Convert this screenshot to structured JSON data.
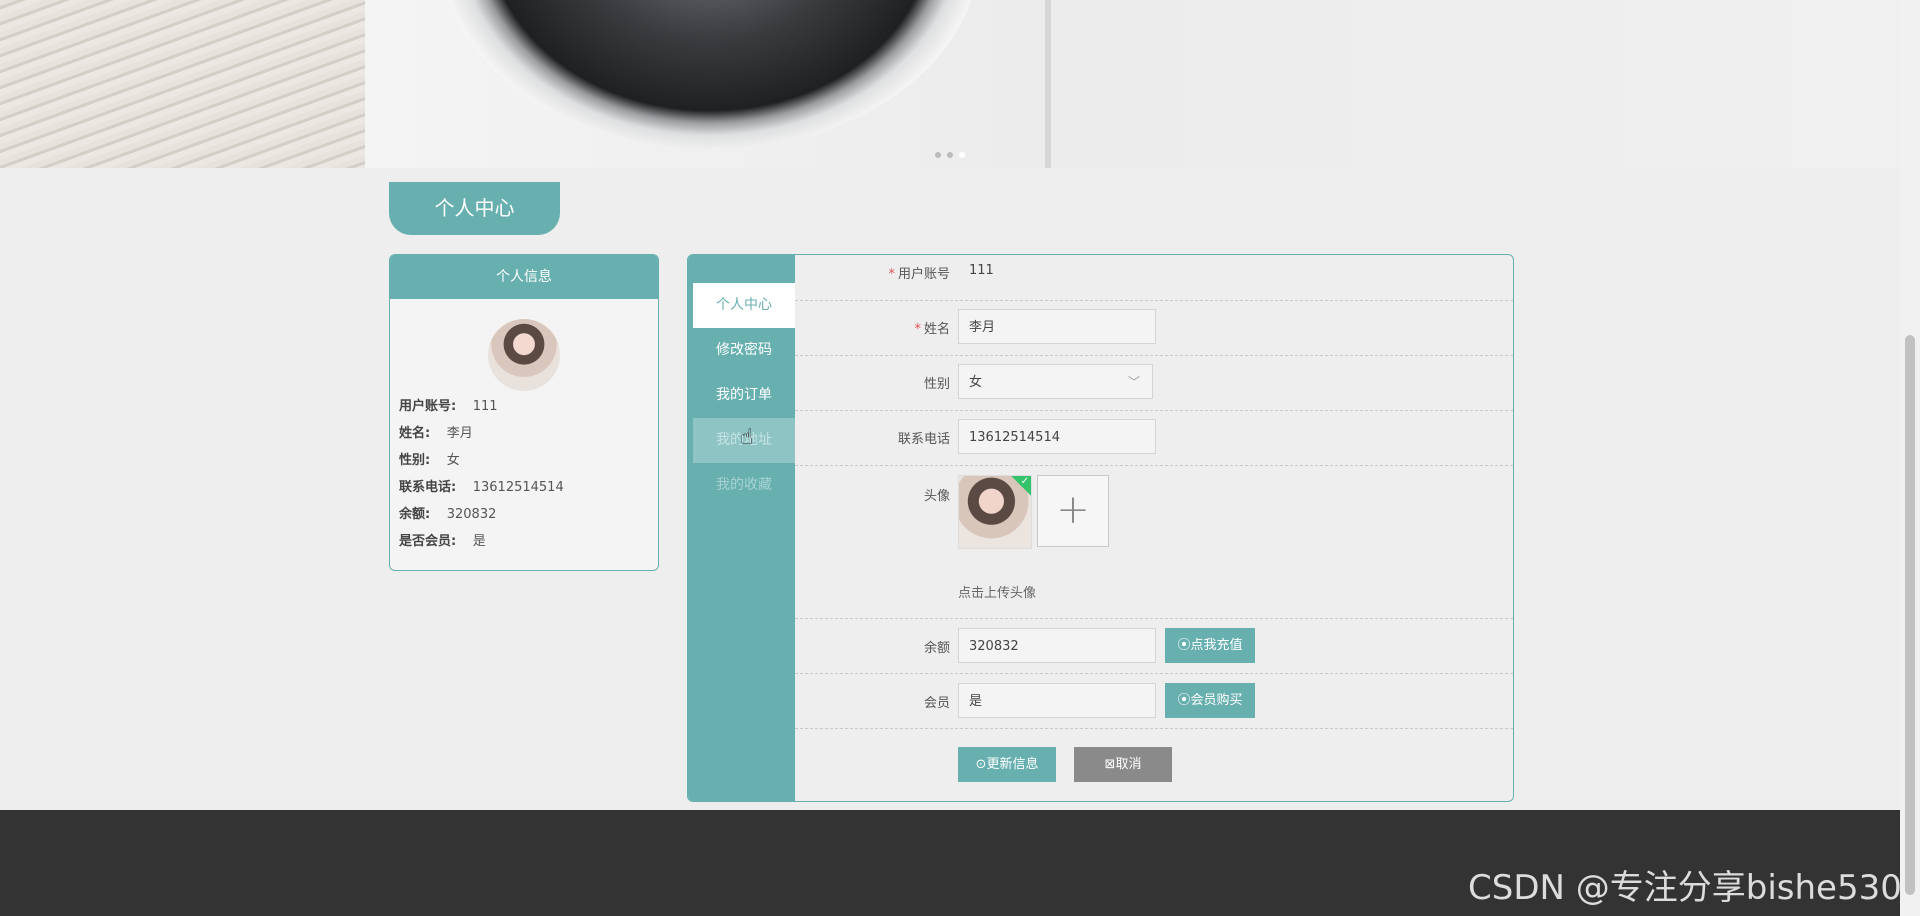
{
  "section_title": "个人中心",
  "info_card": {
    "title": "个人信息",
    "rows": [
      {
        "label": "用户账号:",
        "value": "111"
      },
      {
        "label": "姓名:",
        "value": "李月"
      },
      {
        "label": "性别:",
        "value": "女"
      },
      {
        "label": "联系电话:",
        "value": "13612514514"
      },
      {
        "label": "余额:",
        "value": "320832"
      },
      {
        "label": "是否会员:",
        "value": "是"
      }
    ]
  },
  "side_nav": [
    {
      "label": "个人中心"
    },
    {
      "label": "修改密码"
    },
    {
      "label": "我的订单"
    },
    {
      "label": "我的地址"
    },
    {
      "label": "我的收藏"
    }
  ],
  "form": {
    "account": {
      "label": "用户账号",
      "value": "111"
    },
    "name": {
      "label": "姓名",
      "value": "李月"
    },
    "gender": {
      "label": "性别",
      "value": "女"
    },
    "phone": {
      "label": "联系电话",
      "value": "13612514514"
    },
    "avatar": {
      "label": "头像",
      "hint": "点击上传头像"
    },
    "balance": {
      "label": "余额",
      "value": "320832",
      "button": "点我充值"
    },
    "member": {
      "label": "会员",
      "value": "是",
      "button": "会员购买"
    },
    "update_button": "更新信息",
    "cancel_button": "取消"
  },
  "watermark": "CSDN @专注分享bishe530",
  "colors": {
    "accent": "#68b0b0",
    "footer": "#333333",
    "required": "#e05555",
    "success": "#34c26a"
  }
}
